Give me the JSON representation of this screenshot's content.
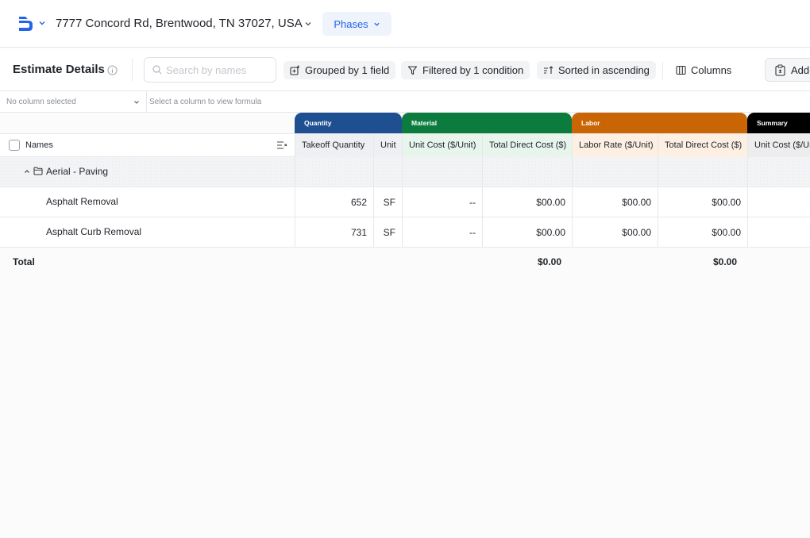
{
  "topbar": {
    "address": "7777 Concord Rd, Brentwood, TN 37027, USA",
    "phases_label": "Phases",
    "brand_color": "#2563eb"
  },
  "toolbar": {
    "title": "Estimate Details",
    "search_placeholder": "Search by names",
    "group_label": "Grouped by 1 field",
    "filter_label": "Filtered by 1 condition",
    "sort_label": "Sorted in ascending",
    "columns_label": "Columns",
    "add_label": "Add-"
  },
  "formula_bar": {
    "column_select": "No column selected",
    "hint": "Select a column to view formula"
  },
  "column_groups": [
    {
      "label": "Quantity",
      "color": "#1d4f91"
    },
    {
      "label": "Material",
      "color": "#0c7c3e"
    },
    {
      "label": "Labor",
      "color": "#c96504"
    },
    {
      "label": "Summary",
      "color": "#000000"
    }
  ],
  "columns": {
    "names": "Names",
    "takeoff_quantity": "Takeoff Quantity",
    "unit": "Unit",
    "material_unit_cost": "Unit Cost ($/Unit)",
    "material_total": "Total Direct Cost ($)",
    "labor_rate": "Labor Rate ($/Unit)",
    "labor_total": "Total Direct Cost ($)",
    "summary_unit_cost": "Unit Cost ($/Un"
  },
  "group_row": {
    "label": "Aerial - Paving"
  },
  "rows": [
    {
      "name": "Asphalt Removal",
      "qty": "652",
      "unit": "SF",
      "mat_unit_cost": "--",
      "mat_total": "$00.00",
      "labor_rate": "$00.00",
      "labor_total": "$00.00"
    },
    {
      "name": "Asphalt Curb Removal",
      "qty": "731",
      "unit": "SF",
      "mat_unit_cost": "--",
      "mat_total": "$00.00",
      "labor_rate": "$00.00",
      "labor_total": "$00.00"
    }
  ],
  "totals": {
    "label": "Total",
    "material_total": "$0.00",
    "labor_total": "$0.00"
  }
}
